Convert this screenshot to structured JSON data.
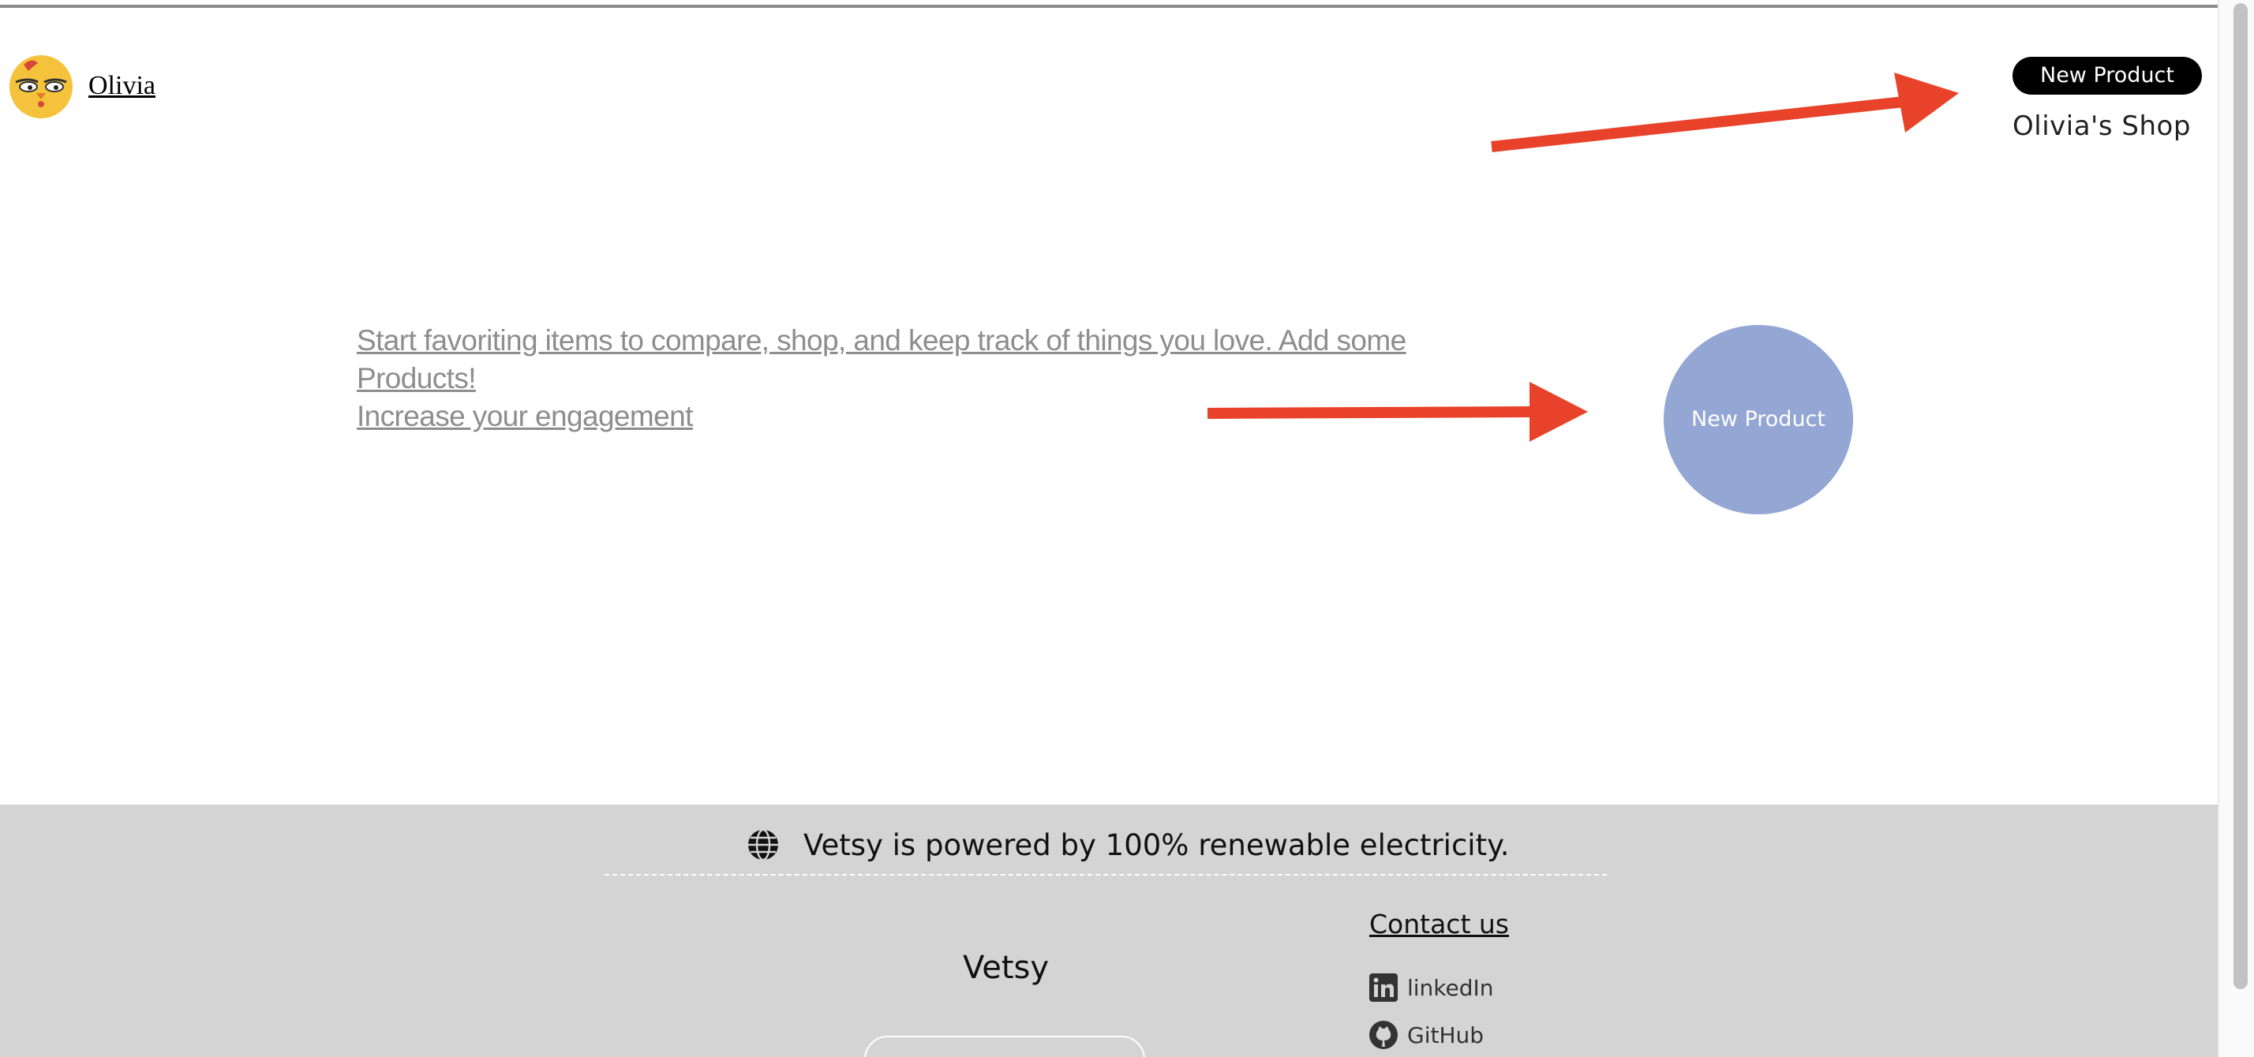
{
  "header": {
    "user_name": "Olivia",
    "new_product_label": "New Product",
    "shop_name": "Olivia's Shop"
  },
  "main": {
    "empty_message_line1": "Start favoriting items to compare, shop, and keep track of things you love. Add some Products!",
    "empty_message_line2": "Increase your engagement",
    "circle_button_label": "New Product"
  },
  "footer": {
    "eco_text": "Vetsy is powered by 100% renewable electricity.",
    "brand": "Vetsy",
    "contact_heading": "Contact us",
    "links": [
      {
        "label": "linkedIn",
        "icon": "linkedin-icon"
      },
      {
        "label": "GitHub",
        "icon": "github-icon"
      }
    ]
  },
  "colors": {
    "annotation_arrow": "#e8432a",
    "circle_button": "#93a6d4",
    "footer_bg": "#d4d4d4",
    "pill_bg": "#000000"
  }
}
